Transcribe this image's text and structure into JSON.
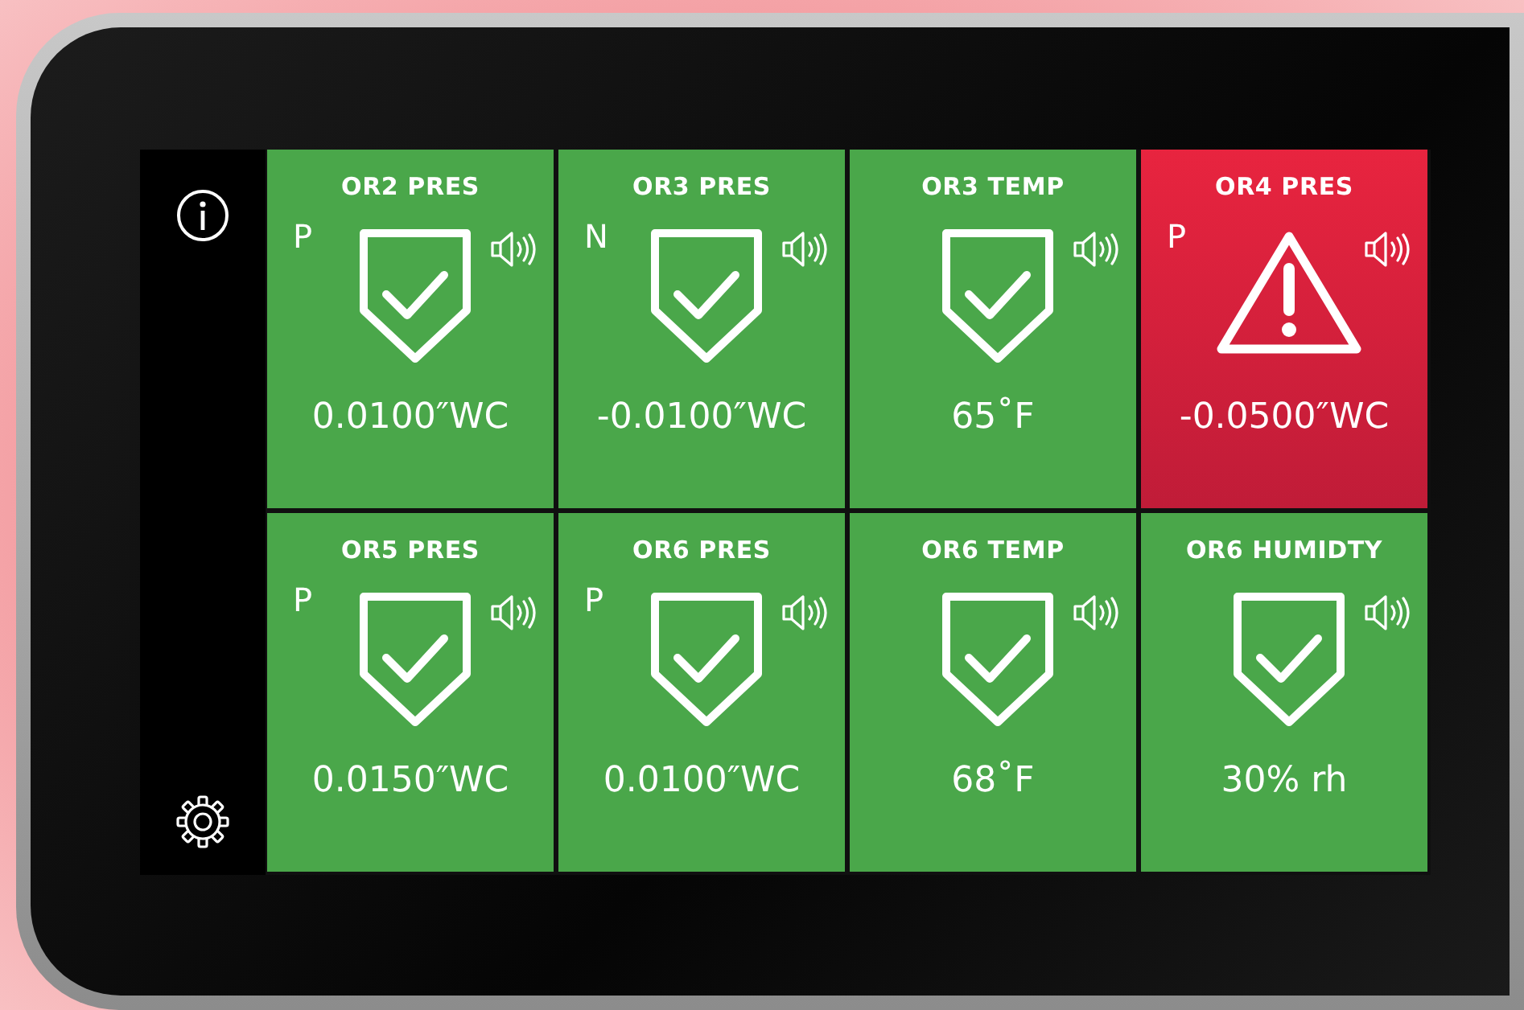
{
  "sidebar": {
    "items": [
      {
        "kind": "info"
      },
      {
        "kind": "settings"
      }
    ]
  },
  "tiles": [
    {
      "title": "OR2 PRES",
      "kind": "ok",
      "mode": "P",
      "reading": "0.0100″WC"
    },
    {
      "title": "OR3 PRES",
      "kind": "ok",
      "mode": "N",
      "reading": "-0.0100″WC"
    },
    {
      "title": "OR3 TEMP",
      "kind": "ok",
      "reading": "65˚F"
    },
    {
      "title": "OR4 PRES",
      "kind": "alarm",
      "mode": "P",
      "reading": "-0.0500″WC"
    },
    {
      "title": "OR5 PRES",
      "kind": "ok",
      "mode": "P",
      "reading": "0.0150″WC"
    },
    {
      "title": "OR6 PRES",
      "kind": "ok",
      "mode": "P",
      "reading": "0.0100″WC"
    },
    {
      "title": "OR6 TEMP",
      "kind": "ok",
      "reading": "68˚F"
    },
    {
      "title": "OR6 HUMIDTY",
      "kind": "ok",
      "reading": "30% rh"
    }
  ]
}
